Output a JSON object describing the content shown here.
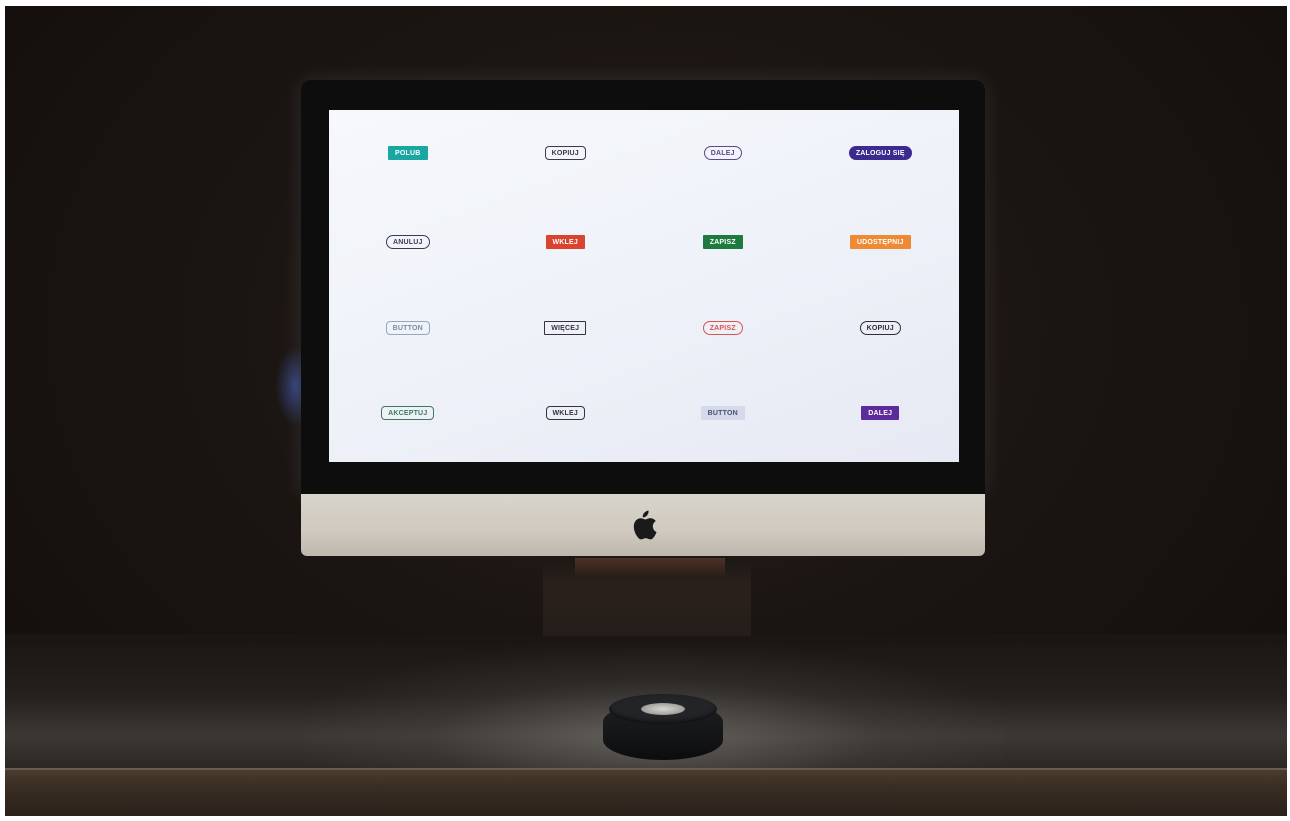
{
  "screen": {
    "buttons": [
      {
        "label": "POLUB",
        "bg": "#1aa7a1",
        "fg": "#ffffff",
        "border": "none",
        "radius": "square"
      },
      {
        "label": "KOPIUJ",
        "bg": "transparent",
        "fg": "#3a3a4a",
        "border": "#3a3a4a",
        "radius": "rounded"
      },
      {
        "label": "DALEJ",
        "bg": "transparent",
        "fg": "#5b4a8a",
        "border": "#5b4a8a",
        "radius": "pill"
      },
      {
        "label": "ZALOGUJ SIĘ",
        "bg": "#3b2a8f",
        "fg": "#ffffff",
        "border": "none",
        "radius": "pill"
      },
      {
        "label": "ANULUJ",
        "bg": "transparent",
        "fg": "#3a3a55",
        "border": "#3a3a55",
        "radius": "pill"
      },
      {
        "label": "WKLEJ",
        "bg": "#d9432f",
        "fg": "#ffffff",
        "border": "none",
        "radius": "square"
      },
      {
        "label": "ZAPISZ",
        "bg": "#1f7a3f",
        "fg": "#ffffff",
        "border": "none",
        "radius": "square"
      },
      {
        "label": "UDOSTĘPNIJ",
        "bg": "#ee8a33",
        "fg": "#ffffff",
        "border": "none",
        "radius": "square"
      },
      {
        "label": "BUTTON",
        "bg": "transparent",
        "fg": "#7d8aa3",
        "border": "#9aa5ba",
        "radius": "rounded"
      },
      {
        "label": "WIĘCEJ",
        "bg": "transparent",
        "fg": "#333340",
        "border": "#333340",
        "radius": "square"
      },
      {
        "label": "ZAPISZ",
        "bg": "transparent",
        "fg": "#d9534f",
        "border": "#d9534f",
        "radius": "pill"
      },
      {
        "label": "KOPIUJ",
        "bg": "transparent",
        "fg": "#2e2e3a",
        "border": "#2e2e3a",
        "radius": "pill"
      },
      {
        "label": "AKCEPTUJ",
        "bg": "transparent",
        "fg": "#3f7a5a",
        "border": "#3f7a5a",
        "radius": "rounded"
      },
      {
        "label": "WKLEJ",
        "bg": "transparent",
        "fg": "#333340",
        "border": "#333340",
        "radius": "rounded"
      },
      {
        "label": "BUTTON",
        "bg": "#d5d9ec",
        "fg": "#4a5070",
        "border": "none",
        "radius": "square"
      },
      {
        "label": "DALEJ",
        "bg": "#5b2a9b",
        "fg": "#ffffff",
        "border": "none",
        "radius": "square"
      }
    ]
  }
}
